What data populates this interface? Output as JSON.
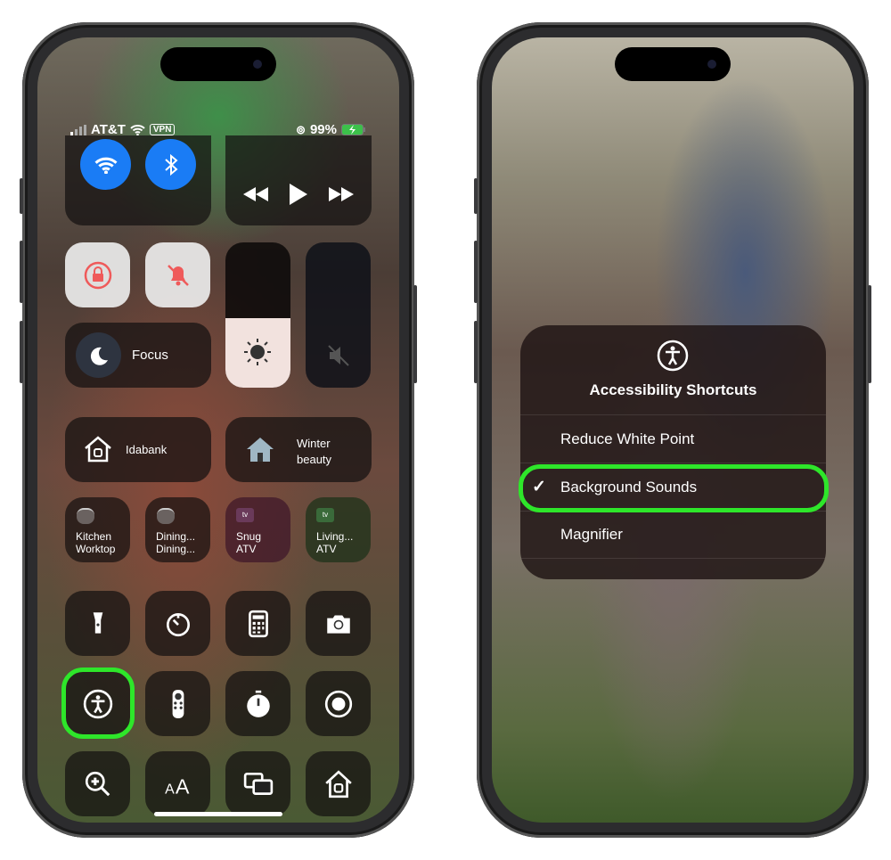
{
  "left_phone": {
    "status_bar": {
      "carrier": "AT&T",
      "vpn": "VPN",
      "battery": "99%",
      "icons": [
        "signal-icon",
        "wifi-icon",
        "orientation-lock-icon",
        "battery-charging-icon"
      ]
    },
    "connectivity": {
      "wifi": true,
      "bluetooth": true
    },
    "media": {
      "icons": [
        "rewind-icon",
        "play-icon",
        "fast-forward-icon"
      ]
    },
    "focus": {
      "label": "Focus"
    },
    "brightness_level": 0.48,
    "volume_muted": true,
    "home": [
      {
        "label": "Idabank"
      },
      {
        "label": "Winter beauty",
        "line1": "Winter",
        "line2": "beauty"
      }
    ],
    "accessories": [
      {
        "line1": "Kitchen",
        "line2": "Worktop",
        "icon": "homepod-icon"
      },
      {
        "line1": "Dining...",
        "line2": "Dining...",
        "icon": "homepod-icon"
      },
      {
        "line1": "Snug",
        "line2": "ATV",
        "icon": "appletv-icon",
        "badge": "tv"
      },
      {
        "line1": "Living...",
        "line2": "ATV",
        "icon": "appletv-icon",
        "badge": "tv"
      }
    ],
    "controls": [
      "flashlight",
      "timer",
      "calculator",
      "camera",
      "accessibility-shortcuts",
      "apple-tv-remote",
      "stopwatch",
      "screen-recording",
      "magnifier",
      "text-size",
      "screen-mirroring",
      "home"
    ],
    "highlight_color": "#2ee62a"
  },
  "right_phone": {
    "menu": {
      "title": "Accessibility Shortcuts",
      "items": [
        {
          "label": "Reduce White Point",
          "checked": false
        },
        {
          "label": "Background Sounds",
          "checked": true
        },
        {
          "label": "Magnifier",
          "checked": false
        }
      ],
      "check": "✓"
    },
    "highlight_color": "#2ee62a"
  }
}
